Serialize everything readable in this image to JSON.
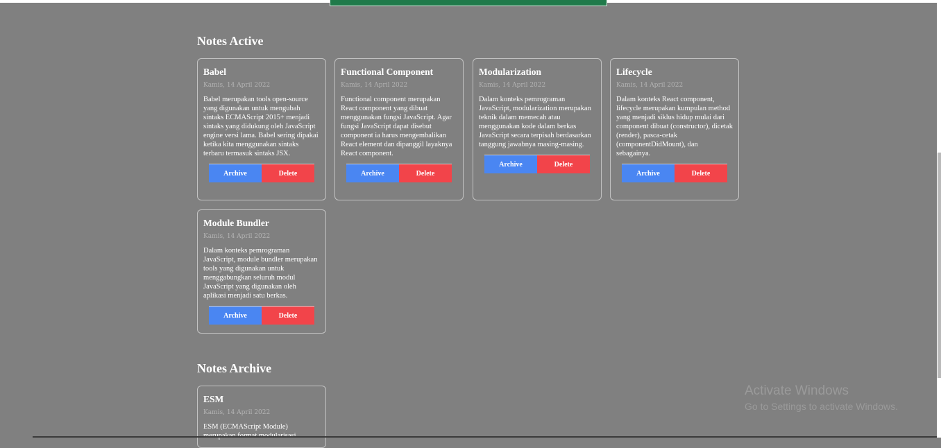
{
  "sections": {
    "active_title": "Notes Active",
    "archive_title": "Notes Archive"
  },
  "notes_active": [
    {
      "title": "Babel",
      "date": "Kamis, 14 April 2022",
      "body": "Babel merupakan tools open-source yang digunakan untuk mengubah sintaks ECMAScript 2015+ menjadi sintaks yang didukung oleh JavaScript engine versi lama. Babel sering dipakai ketika kita menggunakan sintaks terbaru termasuk sintaks JSX.",
      "archive_label": "Archive",
      "delete_label": "Delete"
    },
    {
      "title": "Functional Component",
      "date": "Kamis, 14 April 2022",
      "body": "Functional component merupakan React component yang dibuat menggunakan fungsi JavaScript. Agar fungsi JavaScript dapat disebut component ia harus mengembalikan React element dan dipanggil layaknya React component.",
      "archive_label": "Archive",
      "delete_label": "Delete"
    },
    {
      "title": "Modularization",
      "date": "Kamis, 14 April 2022",
      "body": "Dalam konteks pemrograman JavaScript, modularization merupakan teknik dalam memecah atau menggunakan kode dalam berkas JavaScript secara terpisah berdasarkan tanggung jawabnya masing-masing.",
      "archive_label": "Archive",
      "delete_label": "Delete"
    },
    {
      "title": "Lifecycle",
      "date": "Kamis, 14 April 2022",
      "body": "Dalam konteks React component, lifecycle merupakan kumpulan method yang menjadi siklus hidup mulai dari component dibuat (constructor), dicetak (render), pasca-cetak (componentDidMount), dan sebagainya.",
      "archive_label": "Archive",
      "delete_label": "Delete"
    },
    {
      "title": "Module Bundler",
      "date": "Kamis, 14 April 2022",
      "body": "Dalam konteks pemrograman JavaScript, module bundler merupakan tools yang digunakan untuk menggabungkan seluruh modul JavaScript yang digunakan oleh aplikasi menjadi satu berkas.",
      "archive_label": "Archive",
      "delete_label": "Delete"
    }
  ],
  "notes_archive": [
    {
      "title": "ESM",
      "date": "Kamis, 14 April 2022",
      "body": "ESM (ECMAScript Module) merupakan format modularisasi"
    }
  ],
  "watermark": {
    "title": "Activate Windows",
    "subtitle": "Go to Settings to activate Windows."
  },
  "colors": {
    "background": "#808080",
    "archive_button": "#4a86f2",
    "delete_button": "#f2444a",
    "top_bar": "#1f7a4a"
  }
}
